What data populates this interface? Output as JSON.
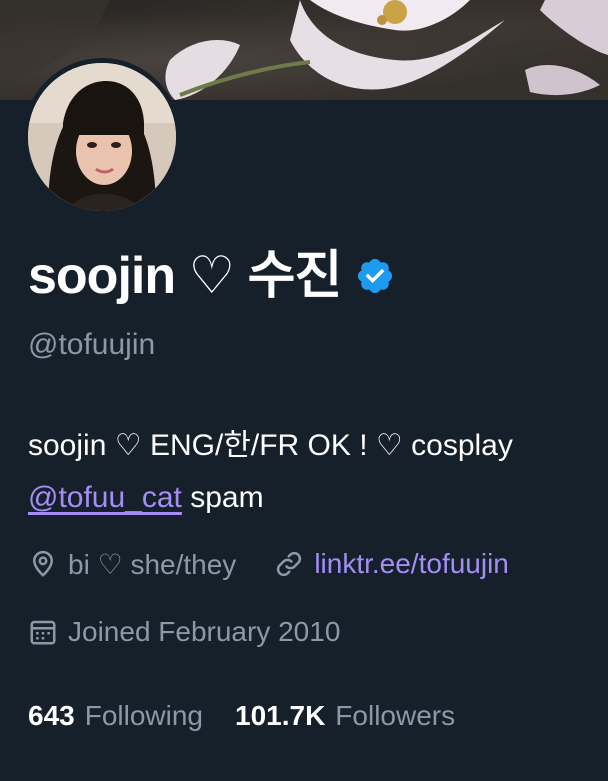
{
  "profile": {
    "display_name": "soojin ♡ 수진",
    "handle": "@tofuujin",
    "verified": true,
    "bio": {
      "line1": "soojin ♡ ENG/한/FR OK ! ♡ cosplay",
      "mention": "@tofuu_cat",
      "line2_rest": " spam"
    },
    "location": "bi ♡ she/they",
    "link": "linktr.ee/tofuujin",
    "joined": "Joined February 2010",
    "following_count": "643",
    "following_label": "Following",
    "followers_count": "101.7K",
    "followers_label": "Followers"
  },
  "colors": {
    "background": "#15202b",
    "secondary_text": "#8b98a5",
    "link": "#a48df5",
    "verified_badge": "#1d9bf0"
  },
  "icons": {
    "location": "location-pin-icon",
    "link": "link-icon",
    "joined": "calendar-icon",
    "verified": "verified-badge-icon"
  }
}
